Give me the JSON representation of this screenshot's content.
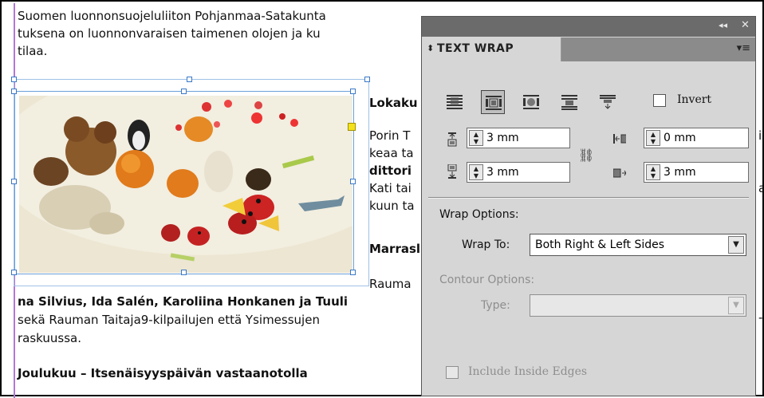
{
  "document": {
    "lines_top": [
      "Suomen luonnonsuojeluliiton Pohjanmaa-Satakunta",
      "tuksena on luonnonvaraisen taimenen olojen ja ku",
      "tilaa."
    ],
    "right_column": {
      "heading1": "Lokaku",
      "para1": [
        "Porin T",
        "keaa ta",
        "dittori",
        "Kati tai",
        "kuun ta"
      ],
      "heading2": "Marrasl",
      "line_after": "Rauma"
    },
    "bottom": {
      "line1": "na Silvius, Ida Salén, Karoliina Honkanen ja Tuuli",
      "line2": "sekä Rauman Taitaja9-kilpailujen että Ysimessujen",
      "line3": "raskuussa.",
      "heading": "Joulukuu – Itsenäisyyspäivän vastaanotolla"
    },
    "right_edge_fragments": [
      "i",
      "a",
      "-"
    ]
  },
  "panel": {
    "title": "TEXT WRAP",
    "title_icon": "up-down-arrows-icon",
    "topbar_buttons": [
      "◂◂",
      "✕"
    ],
    "menu_icon": "panel-menu-icon",
    "wrap_modes": [
      "no-text-wrap",
      "wrap-around-bounding-box",
      "wrap-around-object-shape",
      "jump-object",
      "jump-to-next-column"
    ],
    "selected_wrap_mode": "wrap-around-bounding-box",
    "invert_label": "Invert",
    "invert_checked": false,
    "offsets": {
      "top": "3 mm",
      "bottom": "3 mm",
      "left": "0 mm",
      "right": "3 mm",
      "link_icon": "chain-link-icon"
    },
    "wrap_options_label": "Wrap Options:",
    "wrap_to_label": "Wrap To:",
    "wrap_to_value": "Both Right & Left Sides",
    "contour_options_label": "Contour Options:",
    "type_label": "Type:",
    "type_value": "",
    "include_inside_edges_label": "Include Inside Edges",
    "include_inside_edges_checked": false
  },
  "colors": {
    "panel_bg": "#d6d6d6",
    "selection_frame": "#6aa0d8",
    "margin_guide": "#b277d8",
    "hotspot_handle": "#f2e11c"
  }
}
